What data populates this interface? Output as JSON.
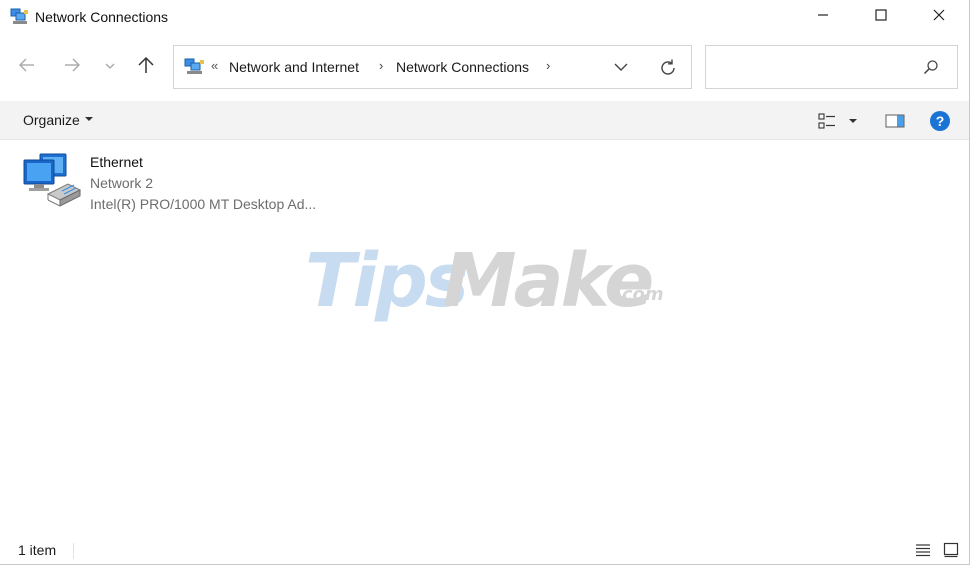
{
  "window": {
    "title": "Network Connections"
  },
  "icons": {
    "app": "network-connections-icon",
    "minimize": "minimize-icon",
    "maximize": "maximize-icon",
    "close": "close-icon",
    "back": "back-arrow-icon",
    "forward": "forward-arrow-icon",
    "recent": "chevron-down-icon",
    "up": "up-arrow-icon",
    "refresh": "refresh-icon",
    "search": "search-icon",
    "view_options": "view-options-icon",
    "preview_pane": "preview-pane-icon",
    "help": "help-icon",
    "details_view": "details-view-icon",
    "large_icons_view": "large-icons-view-icon"
  },
  "address": {
    "overflow": "«",
    "breadcrumbs": [
      "Network and Internet",
      "Network Connections"
    ],
    "separator": "›"
  },
  "search": {
    "placeholder": ""
  },
  "command_bar": {
    "organize_label": "Organize",
    "help_glyph": "?"
  },
  "items": [
    {
      "name": "Ethernet",
      "network": "Network 2",
      "adapter": "Intel(R) PRO/1000 MT Desktop Ad..."
    }
  ],
  "watermark": {
    "part1": "Tips",
    "part2": "Make",
    "part3": ".com"
  },
  "status": {
    "count": "1 item"
  },
  "colors": {
    "accent": "#0067c0",
    "help_blue": "#1a74d6",
    "commandbar_bg": "#f3f3f3",
    "muted_text": "#6d6d6d"
  }
}
